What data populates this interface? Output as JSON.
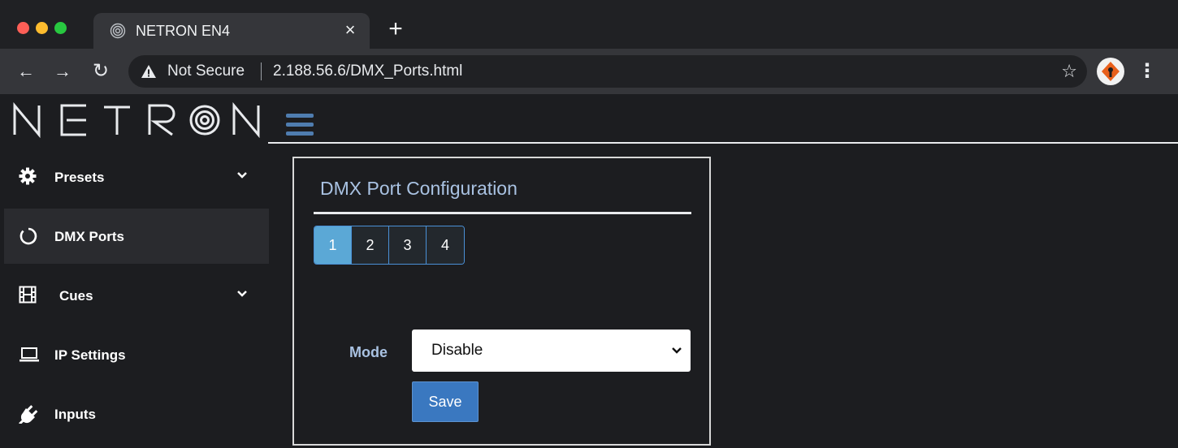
{
  "browser": {
    "tab_title": "NETRON EN4",
    "tab_close": "×",
    "new_tab": "+",
    "security_label": "Not Secure",
    "url": "2.188.56.6/DMX_Ports.html",
    "icons": {
      "back": "back-arrow-icon",
      "forward": "forward-arrow-icon",
      "reload": "reload-icon",
      "warning": "warning-icon",
      "star": "bookmark-star-icon",
      "menu": "menu-dots-icon"
    }
  },
  "app": {
    "logo_text": "NETRON",
    "sidebar": {
      "items": [
        {
          "label": "Presets",
          "icon": "gear-icon",
          "expandable": true
        },
        {
          "label": "DMX Ports",
          "icon": "circle-ring-icon",
          "expandable": false
        },
        {
          "label": "Cues",
          "icon": "film-icon",
          "expandable": true
        },
        {
          "label": "IP Settings",
          "icon": "laptop-icon",
          "expandable": false
        },
        {
          "label": "Inputs",
          "icon": "plug-icon",
          "expandable": false
        }
      ]
    },
    "card": {
      "title": "DMX Port Configuration",
      "ports": [
        "1",
        "2",
        "3",
        "4"
      ],
      "active_port": "1",
      "mode_label": "Mode",
      "mode_value": "Disable",
      "save_label": "Save"
    },
    "colors": {
      "accent_blue": "#3a78c0",
      "active_tab": "#5ba8d6",
      "label_blue": "#a9c2e2"
    }
  }
}
